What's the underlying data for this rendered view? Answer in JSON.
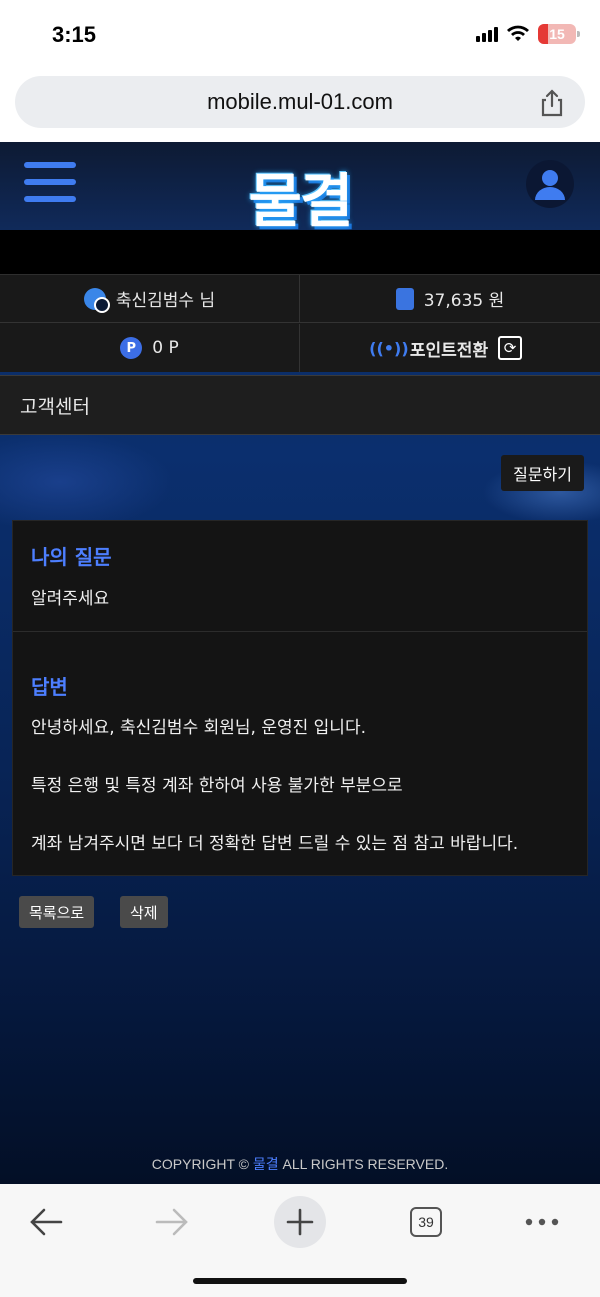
{
  "status_bar": {
    "time": "3:15",
    "battery": "15"
  },
  "browser": {
    "url": "mobile.mul-01.com",
    "tab_count": "39"
  },
  "header": {
    "logo": "물결"
  },
  "user_info": {
    "username": "축신김범수 님",
    "balance": "37,635 원",
    "points": "0 P",
    "point_exchange_label": "포인트전환"
  },
  "page": {
    "title": "고객센터",
    "ask_button": "질문하기"
  },
  "question": {
    "title": "나의 질문",
    "body": "알려주세요"
  },
  "answer": {
    "title": "답변",
    "lines": [
      "안녕하세요, 축신김범수 회원님, 운영진 입니다.",
      "특정 은행 및 특정 계좌 한하여 사용 불가한 부분으로",
      "계좌 남겨주시면 보다 더 정확한 답변 드릴 수 있는 점 참고 바랍니다."
    ]
  },
  "actions": {
    "list_button": "목록으로",
    "delete_button": "삭제"
  },
  "footer": {
    "copyright_prefix": "COPYRIGHT © ",
    "brand": "물결",
    "copyright_suffix": " ALL RIGHTS RESERVED."
  },
  "icons": {
    "back": "arrow-left-icon",
    "forward": "arrow-right-icon",
    "new_tab": "plus-icon",
    "tabs": "tab-count-icon",
    "more": "more-dots-icon",
    "share": "share-icon",
    "menu": "hamburger-icon",
    "profile": "profile-icon",
    "refresh": "refresh-icon"
  },
  "colors": {
    "accent": "#4d7fff",
    "menu": "#3f7cf0"
  }
}
